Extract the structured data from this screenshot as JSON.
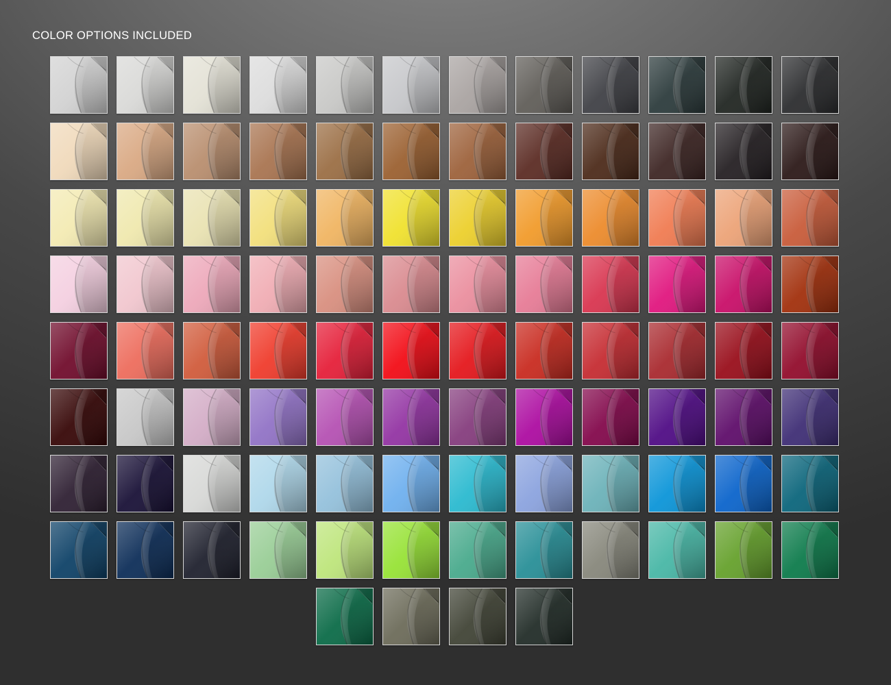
{
  "heading": "COLOR OPTIONS INCLUDED",
  "swatch_colors": [
    [
      "#d2d2d2",
      "#d9d9d7",
      "#e3e1d5",
      "#dcdcdc",
      "#c8c8c6",
      "#c6c7ca",
      "#a9a3a1",
      "#5f5c57",
      "#3e3f44",
      "#2b3a3b",
      "#1f2420",
      "#2a2b2d"
    ],
    [
      "#f0d9ba",
      "#d9a882",
      "#b88d6d",
      "#a8734f",
      "#9a6d43",
      "#9a5f2f",
      "#9c6039",
      "#5a2a22",
      "#4b2918",
      "#3c2422",
      "#231e21",
      "#2a1716"
    ],
    [
      "#f3eab2",
      "#efe8ad",
      "#e9e2b1",
      "#f2df7a",
      "#f0b460",
      "#f0e12c",
      "#eccf2a",
      "#f19a29",
      "#ec8a2a",
      "#f07a50",
      "#eca276",
      "#c85a38"
    ],
    [
      "#f4cfe0",
      "#f1c6ce",
      "#eda7b9",
      "#f0acb3",
      "#d88e7e",
      "#d9898e",
      "#ea8d9d",
      "#e67a95",
      "#d8334e",
      "#e0147d",
      "#c80c67",
      "#a12e0a"
    ],
    [
      "#6f0a2a",
      "#ed6b5b",
      "#d05a3a",
      "#ef3a2a",
      "#e51d37",
      "#f20a14",
      "#e4151a",
      "#c8291e",
      "#c52a30",
      "#a8282d",
      "#980c19",
      "#910a2a"
    ],
    [
      "#350505",
      "#c7c7c7",
      "#d3acc6",
      "#9071c5",
      "#b44fb2",
      "#9232a2",
      "#843b7c",
      "#ac0aa0",
      "#82064a",
      "#4e0a84",
      "#5d0b69",
      "#3d2c74"
    ],
    [
      "#2d1e31",
      "#170f35",
      "#d7d8d6",
      "#aed7ea",
      "#93c0db",
      "#6dafee",
      "#28b9cf",
      "#8aa2de",
      "#6ab1b8",
      "#0994d8",
      "#0963cb",
      "#09647a"
    ],
    [
      "#0c4066",
      "#0b2c57",
      "#1d1f2c",
      "#98cd95",
      "#bde57a",
      "#96e234",
      "#47a98b",
      "#268e96",
      "#86867a",
      "#46b6a5",
      "#64a02a",
      "#0b7a4a"
    ],
    [
      "#096a46",
      "#6b6a58",
      "#3f4234",
      "#202b26"
    ]
  ]
}
